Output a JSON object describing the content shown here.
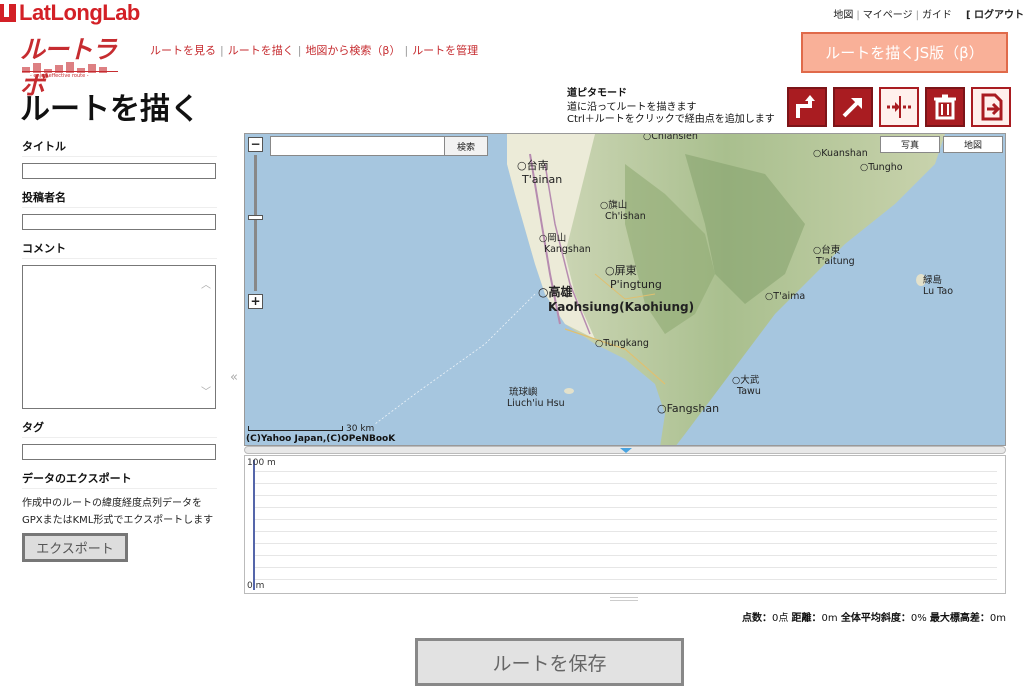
{
  "brand": {
    "name": "LatLongLab"
  },
  "toplinks": {
    "map": "地図",
    "mypage": "マイページ",
    "guide": "ガイド",
    "logout": "[ ログアウト"
  },
  "logo": {
    "text": "ルートラボ",
    "sub": "- enjoy effective route -"
  },
  "nav": [
    {
      "label": "ルートを見る"
    },
    {
      "label": "ルートを描く"
    },
    {
      "label": "地図から検索（β）"
    },
    {
      "label": "ルートを管理"
    }
  ],
  "js_button": "ルートを描くJS版（β）",
  "page_title": "ルートを描く",
  "mode": {
    "title": "道ピタモード",
    "line1": "道に沿ってルートを描きます",
    "line2": "Ctrl＋ルートをクリックで経由点を追加します"
  },
  "tool_icons": [
    "road-snap-icon",
    "straight-line-icon",
    "split-point-icon",
    "trash-icon",
    "import-file-icon"
  ],
  "form": {
    "title_label": "タイトル",
    "author_label": "投稿者名",
    "comment_label": "コメント",
    "tag_label": "タグ",
    "export_heading": "データのエクスポート",
    "export_desc": "作成中のルートの緯度経度点列データをGPXまたはKML形式でエクスポートします",
    "export_button": "エクスポート"
  },
  "map": {
    "search_button": "検索",
    "type_photo": "写真",
    "type_map": "地図",
    "zoom_in": "+",
    "zoom_out": "−",
    "scale": "30 km",
    "copyright": "(C)Yahoo Japan,(C)OPeNBooK",
    "places": [
      {
        "jp": "",
        "en": "Chiansien"
      },
      {
        "jp": "台南",
        "en": "T'ainan"
      },
      {
        "jp": "旗山",
        "en": "Ch'ishan"
      },
      {
        "jp": "岡山",
        "en": "Kangshan"
      },
      {
        "jp": "屏東",
        "en": "P'ingtung"
      },
      {
        "jp": "高雄",
        "en": "Kaohsiung(Kaohiung)"
      },
      {
        "jp": "",
        "en": "Kuanshan"
      },
      {
        "jp": "",
        "en": "Tungho"
      },
      {
        "jp": "台東",
        "en": "T'aitung"
      },
      {
        "jp": "緑島",
        "en": "Lu Tao"
      },
      {
        "jp": "",
        "en": "T'aima"
      },
      {
        "jp": "",
        "en": "Tungkang"
      },
      {
        "jp": "琉球嶼",
        "en": "Liuch'iu Hsu"
      },
      {
        "jp": "大武",
        "en": "Tawu"
      },
      {
        "jp": "",
        "en": "Fangshan"
      }
    ]
  },
  "elevation": {
    "max_label": "100 m",
    "min_label": "0 m"
  },
  "stats": {
    "points_label": "点数：",
    "points_value": "0点",
    "distance_label": "距離：",
    "distance_value": "0m",
    "slope_label": "全体平均斜度：",
    "slope_value": "0%",
    "elev_label": "最大標高差：",
    "elev_value": "0m"
  },
  "save_button": "ルートを保存"
}
